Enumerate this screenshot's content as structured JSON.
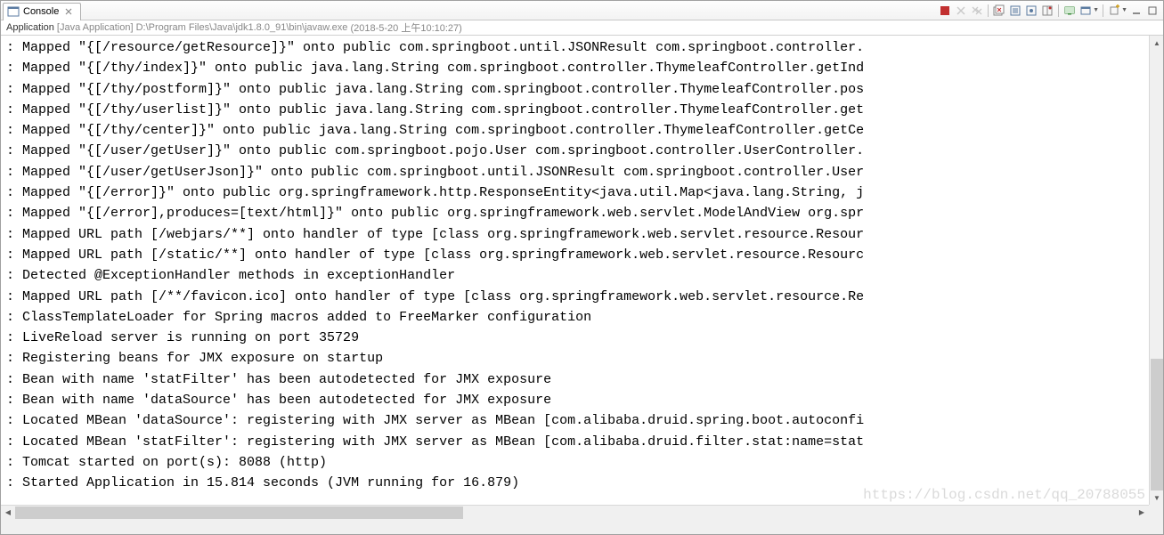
{
  "tab": {
    "title": "Console",
    "close_icon": "close-icon"
  },
  "launch": {
    "name": "Application",
    "type": "[Java Application]",
    "path": "D:\\Program Files\\Java\\jdk1.8.0_91\\bin\\javaw.exe",
    "timestamp": "(2018-5-20 上午10:10:27)"
  },
  "console_lines": [
    ": Mapped \"{[/resource/getResource]}\" onto public com.springboot.until.JSONResult com.springboot.controller.",
    ": Mapped \"{[/thy/index]}\" onto public java.lang.String com.springboot.controller.ThymeleafController.getInd",
    ": Mapped \"{[/thy/postform]}\" onto public java.lang.String com.springboot.controller.ThymeleafController.pos",
    ": Mapped \"{[/thy/userlist]}\" onto public java.lang.String com.springboot.controller.ThymeleafController.get",
    ": Mapped \"{[/thy/center]}\" onto public java.lang.String com.springboot.controller.ThymeleafController.getCe",
    ": Mapped \"{[/user/getUser]}\" onto public com.springboot.pojo.User com.springboot.controller.UserController.",
    ": Mapped \"{[/user/getUserJson]}\" onto public com.springboot.until.JSONResult com.springboot.controller.User",
    ": Mapped \"{[/error]}\" onto public org.springframework.http.ResponseEntity<java.util.Map<java.lang.String, j",
    ": Mapped \"{[/error],produces=[text/html]}\" onto public org.springframework.web.servlet.ModelAndView org.spr",
    ": Mapped URL path [/webjars/**] onto handler of type [class org.springframework.web.servlet.resource.Resour",
    ": Mapped URL path [/static/**] onto handler of type [class org.springframework.web.servlet.resource.Resourc",
    ": Detected @ExceptionHandler methods in exceptionHandler",
    ": Mapped URL path [/**/favicon.ico] onto handler of type [class org.springframework.web.servlet.resource.Re",
    ": ClassTemplateLoader for Spring macros added to FreeMarker configuration",
    ": LiveReload server is running on port 35729",
    ": Registering beans for JMX exposure on startup",
    ": Bean with name 'statFilter' has been autodetected for JMX exposure",
    ": Bean with name 'dataSource' has been autodetected for JMX exposure",
    ": Located MBean 'dataSource': registering with JMX server as MBean [com.alibaba.druid.spring.boot.autoconfi",
    ": Located MBean 'statFilter': registering with JMX server as MBean [com.alibaba.druid.filter.stat:name=stat",
    ": Tomcat started on port(s): 8088 (http)",
    ": Started Application in 15.814 seconds (JVM running for 16.879)"
  ],
  "watermark": "https://blog.csdn.net/qq_20788055",
  "toolbar_icons": {
    "terminate": "terminate-icon",
    "remove_launch": "remove-launch-icon",
    "remove_all": "remove-all-icon",
    "clear": "clear-icon",
    "scroll_lock": "scroll-lock-icon",
    "word_wrap": "word-wrap-icon",
    "pin": "pin-icon",
    "display": "display-icon",
    "open_console": "open-console-icon",
    "minimize": "minimize-icon",
    "maximize": "maximize-icon"
  }
}
